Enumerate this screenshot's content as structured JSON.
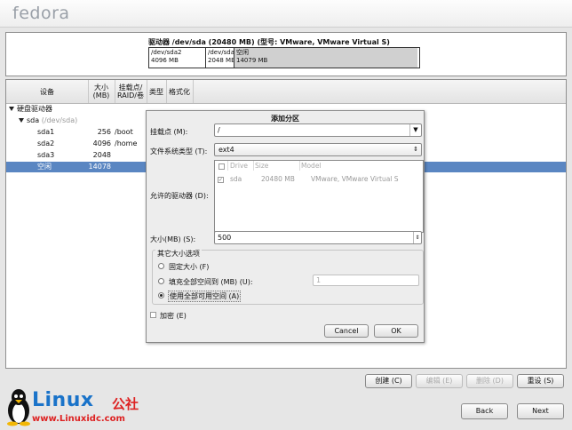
{
  "brand": {
    "logo_text": "fedora",
    "watermark_main": "Linux",
    "watermark_cn": "公社",
    "watermark_url": "www.Linuxidc.com"
  },
  "drive_panel": {
    "title": "驱动器 /dev/sda (20480 MB) (型号: VMware, VMware Virtual S)",
    "segments": [
      {
        "name": "/dev/sda2",
        "size": "4096 MB"
      },
      {
        "name": "/dev/sda",
        "size": "2048 MB"
      },
      {
        "name": "/dev/sda",
        "size": ""
      },
      {
        "name": "空闲",
        "size": "14079 MB"
      }
    ]
  },
  "tree": {
    "headers": {
      "device": "设备",
      "size": "大小\n(MB)",
      "mount": "挂载点/\nRAID/卷",
      "type": "类型",
      "format": "格式化"
    },
    "root": "硬盘驱动器",
    "disk": {
      "name": "sda",
      "path": "(/dev/sda)"
    },
    "rows": [
      {
        "device": "sda1",
        "size": "256",
        "mount": "/boot"
      },
      {
        "device": "sda2",
        "size": "4096",
        "mount": "/home"
      },
      {
        "device": "sda3",
        "size": "2048",
        "mount": ""
      },
      {
        "device": "空闲",
        "size": "14078",
        "mount": ""
      }
    ]
  },
  "dialog": {
    "title": "添加分区",
    "mount_label": "挂载点 (M):",
    "mount_value": "/",
    "fs_label": "文件系统类型 (T):",
    "fs_value": "ext4",
    "drives_label": "允许的驱动器 (D):",
    "drives_headers": {
      "drive": "Drive",
      "size": "Size",
      "model": "Model"
    },
    "drive_row": {
      "drive": "sda",
      "size": "20480 MB",
      "model": "VMware, VMware Virtual S"
    },
    "size_label": "大小(MB) (S):",
    "size_value": "500",
    "options_title": "其它大小选项",
    "opt_fixed": "固定大小 (F)",
    "opt_fill_upto": "填充全部空间到 (MB) (U):",
    "fill_value": "1",
    "opt_fill_max": "使用全部可用空间 (A)",
    "encrypt": "加密 (E)",
    "cancel": "Cancel",
    "ok": "OK"
  },
  "actions": {
    "create": "创建 (C)",
    "edit": "编辑 (E)",
    "delete": "删除 (D)",
    "reset": "重设 (S)"
  },
  "nav": {
    "back": "Back",
    "next": "Next"
  }
}
